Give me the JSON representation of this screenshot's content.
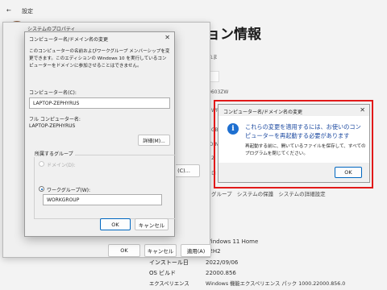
{
  "settings": {
    "back_glyph": "←",
    "title": "設定",
    "search_partial": "設",
    "heading": "ョン情報",
    "partial_text": {
      "t1": "更われま",
      "t2": "0603ZW",
      "t3": "WP",
      "t4": "GB",
      "t5": "ID(N)...",
      "t6": "2",
      "t7": "ロ"
    },
    "info": [
      {
        "label": "",
        "value": "Windows 11 Home"
      },
      {
        "label": "",
        "value": "22H2"
      },
      {
        "label": "インストール日",
        "value": "2022/09/06"
      },
      {
        "label": "OS ビルド",
        "value": "22000.856"
      },
      {
        "label": "エクスペリエンス",
        "value": "Windows 機能エクスペリエンス パック 1000.22000.856.0"
      }
    ],
    "links": [
      "グループ",
      "システムの保護",
      "システムの詳細設定"
    ]
  },
  "system_properties": {
    "title": "システムのプロパティ",
    "ok": "OK",
    "cancel": "キャンセル",
    "apply": "適用(A)",
    "change": "(C)..."
  },
  "computer_name_dialog": {
    "title": "コンピューター名/ドメイン名の変更",
    "close": "✕",
    "description": "このコンピューターの名前およびワークグループ メンバーシップを変更できます。このエディションの Windows 10 を実行しているコンピューターをドメインに参加させることはできません。",
    "computer_name_label": "コンピューター名(C):",
    "computer_name_value": "LAPTOP-ZEPHYRUS",
    "full_name_label": "フル コンピューター名:",
    "full_name_value": "LAPTOP-ZEPHYRUS",
    "details_button": "詳細(M)...",
    "member_of_label": "所属するグループ",
    "domain_label": "ドメイン(D):",
    "workgroup_label": "ワークグループ(W):",
    "workgroup_value": "WORKGROUP",
    "ok": "OK",
    "cancel": "キャンセル"
  },
  "restart_dialog": {
    "title": "コンピューター名/ドメイン名の変更",
    "close": "✕",
    "message": "これらの変更を適用するには、お使いのコンピューターを再起動する必要があります",
    "detail": "再起動する前に、開いているファイルを保存して、すべてのプログラムを閉じてください。",
    "ok": "OK",
    "highlight_color": "#e11919",
    "message_color": "#1d4aa0"
  }
}
